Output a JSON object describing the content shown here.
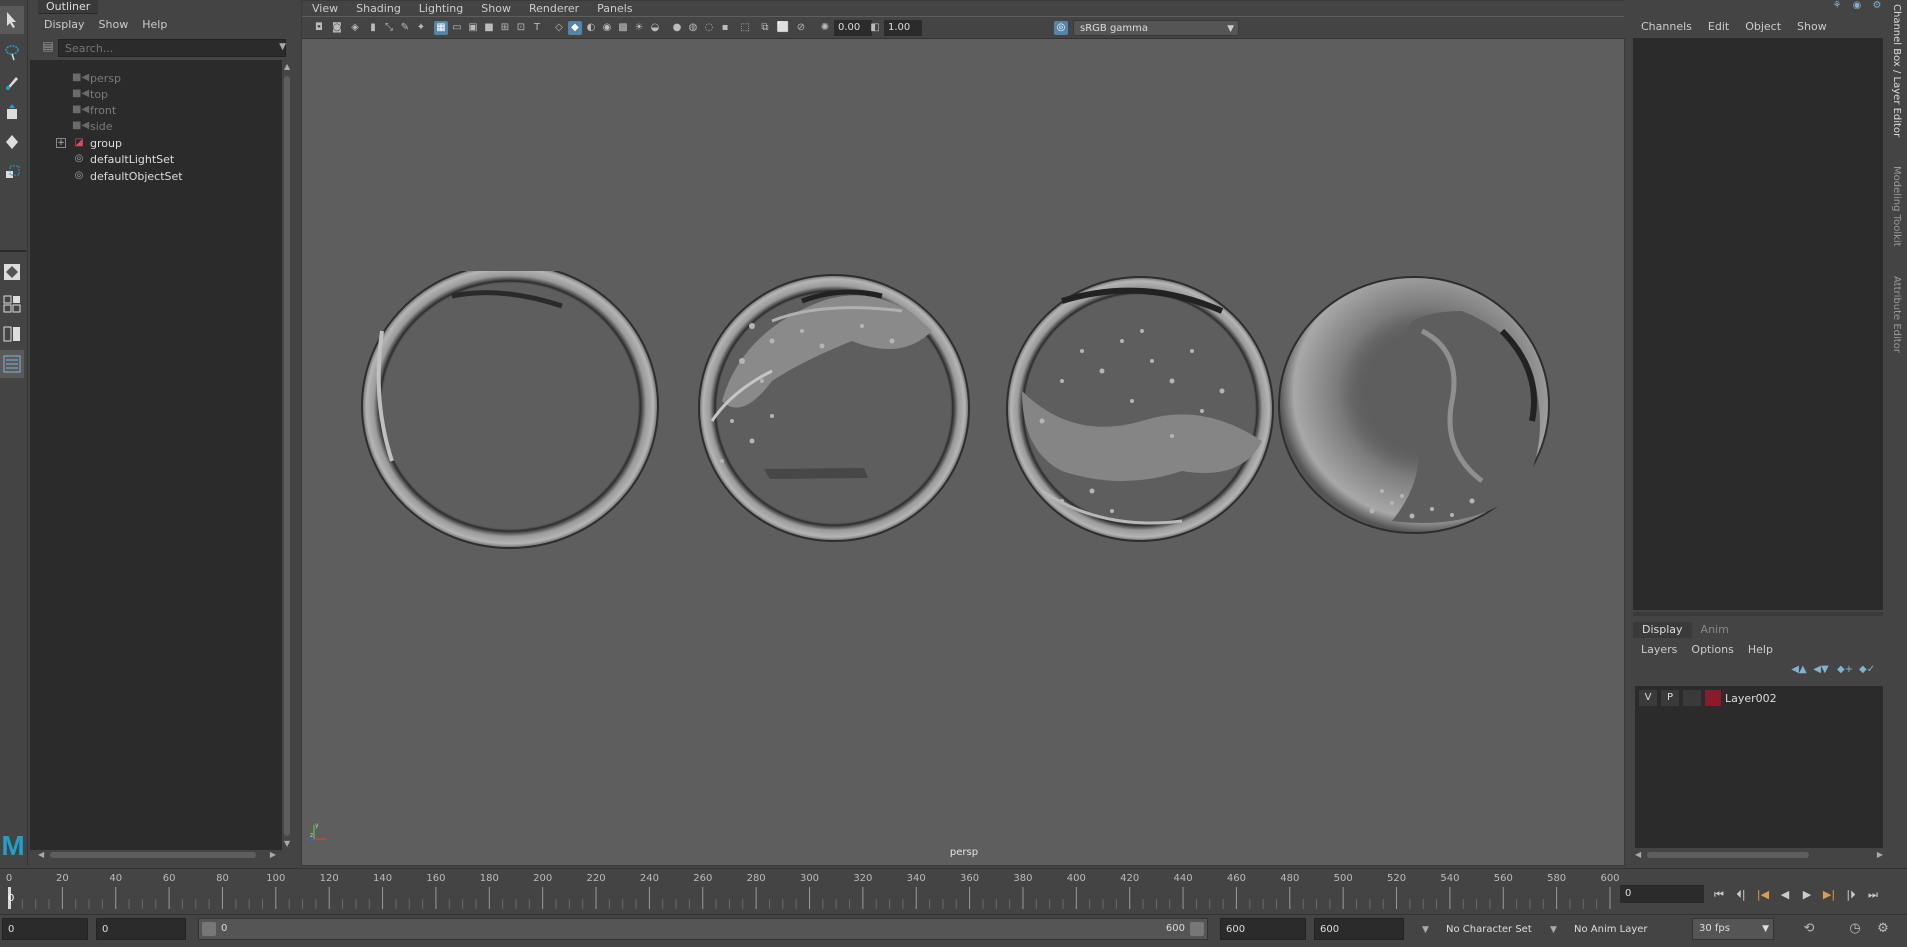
{
  "outliner": {
    "tab": "Outliner",
    "menu": [
      "Display",
      "Show",
      "Help"
    ],
    "search_placeholder": "Search...",
    "items": [
      {
        "label": "persp",
        "icon": "camera-icon",
        "dim": true
      },
      {
        "label": "top",
        "icon": "camera-icon",
        "dim": true
      },
      {
        "label": "front",
        "icon": "camera-icon",
        "dim": true
      },
      {
        "label": "side",
        "icon": "camera-icon",
        "dim": true
      },
      {
        "label": "group",
        "icon": "group-icon",
        "dim": false,
        "expandable": true
      },
      {
        "label": "defaultLightSet",
        "icon": "set-icon",
        "dim": false
      },
      {
        "label": "defaultObjectSet",
        "icon": "set-icon",
        "dim": false
      }
    ]
  },
  "viewport": {
    "menu": [
      "View",
      "Shading",
      "Lighting",
      "Show",
      "Renderer",
      "Panels"
    ],
    "exposure": "0.00",
    "gamma": "1.00",
    "colorspace": "sRGB gamma",
    "camera_label": "persp"
  },
  "channel_box": {
    "menu": [
      "Channels",
      "Edit",
      "Object",
      "Show"
    ]
  },
  "layer_editor": {
    "tabs": [
      "Display",
      "Anim"
    ],
    "active_tab": "Display",
    "menu": [
      "Layers",
      "Options",
      "Help"
    ],
    "layer": {
      "visible": "V",
      "playback": "P",
      "name": "Layer002",
      "color": "#8b1a2a"
    }
  },
  "side_tabs": [
    "Channel Box / Layer Editor",
    "Modeling Toolkit",
    "Attribute Editor"
  ],
  "time_slider": {
    "labels": [
      "0",
      "20",
      "40",
      "60",
      "80",
      "100",
      "120",
      "140",
      "160",
      "180",
      "200",
      "220",
      "240",
      "260",
      "280",
      "300",
      "320",
      "340",
      "360",
      "380",
      "400",
      "420",
      "440",
      "460",
      "480",
      "500",
      "520",
      "540",
      "560",
      "580",
      "600"
    ],
    "playhead": "0",
    "current_frame": "0"
  },
  "range_slider": {
    "start_time": "0",
    "playback_start": "0",
    "range_left": "0",
    "range_right": "600",
    "playback_end": "600",
    "end_time": "600",
    "character_set": "No Character Set",
    "anim_layer": "No Anim Layer",
    "fps": "30 fps"
  },
  "colors": {
    "accent": "#5285a6",
    "maya_logo": "#1fa0c8",
    "key_frame": "#d6a04a"
  }
}
